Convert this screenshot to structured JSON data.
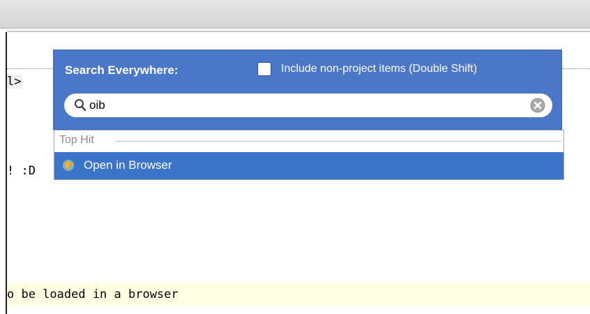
{
  "editor": {
    "line_1": "l>",
    "line_2": "! :D",
    "line_3": "o be loaded in a browser"
  },
  "popup": {
    "title": "Search Everywhere:",
    "include_label": "Include non-project items (Double Shift)",
    "include_checked": false,
    "search_value": "oib",
    "accent_color": "#4a77c7"
  },
  "results": {
    "group_label": "Top Hit",
    "items": [
      {
        "label": "Open in Browser",
        "icon": "browser-icon",
        "selected": true
      }
    ],
    "selected_color": "#3b74c9"
  }
}
